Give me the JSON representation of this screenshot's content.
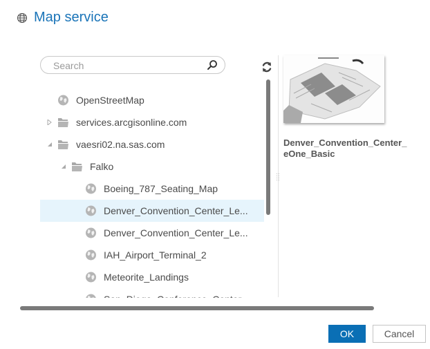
{
  "dialog": {
    "title": "Map service",
    "title_icon": "globe-icon",
    "accent_color": "#1a74b8"
  },
  "search": {
    "placeholder": "Search",
    "value": "",
    "icon": "search-icon"
  },
  "refresh": {
    "icon": "refresh-icon"
  },
  "tree": {
    "items": [
      {
        "label": "OpenStreetMap",
        "type": "map",
        "level": 0,
        "expander": "none",
        "selected": false
      },
      {
        "label": "services.arcgisonline.com",
        "type": "folder",
        "level": 0,
        "expander": "collapsed",
        "selected": false
      },
      {
        "label": "vaesri02.na.sas.com",
        "type": "folder",
        "level": 0,
        "expander": "expanded",
        "selected": false
      },
      {
        "label": "Falko",
        "type": "folder",
        "level": 1,
        "expander": "expanded",
        "selected": false
      },
      {
        "label": "Boeing_787_Seating_Map",
        "type": "map",
        "level": 2,
        "expander": "none",
        "selected": false
      },
      {
        "label": "Denver_Convention_Center_Le...",
        "type": "map",
        "level": 2,
        "expander": "none",
        "selected": true
      },
      {
        "label": "Denver_Convention_Center_Le...",
        "type": "map",
        "level": 2,
        "expander": "none",
        "selected": false
      },
      {
        "label": "IAH_Airport_Terminal_2",
        "type": "map",
        "level": 2,
        "expander": "none",
        "selected": false
      },
      {
        "label": "Meteorite_Landings",
        "type": "map",
        "level": 2,
        "expander": "none",
        "selected": false
      },
      {
        "label": "San_Diego_Conference_Center",
        "type": "map",
        "level": 2,
        "expander": "none",
        "selected": false
      }
    ]
  },
  "preview": {
    "name": "Denver_Convention_Center_eOne_Basic",
    "name_line1": "Denver_Convention_Center_",
    "name_line2": "eOne_Basic",
    "thumbnail": "floor-plan-thumbnail"
  },
  "buttons": {
    "ok": "OK",
    "cancel": "Cancel",
    "ok_color": "#0a6fb5"
  }
}
